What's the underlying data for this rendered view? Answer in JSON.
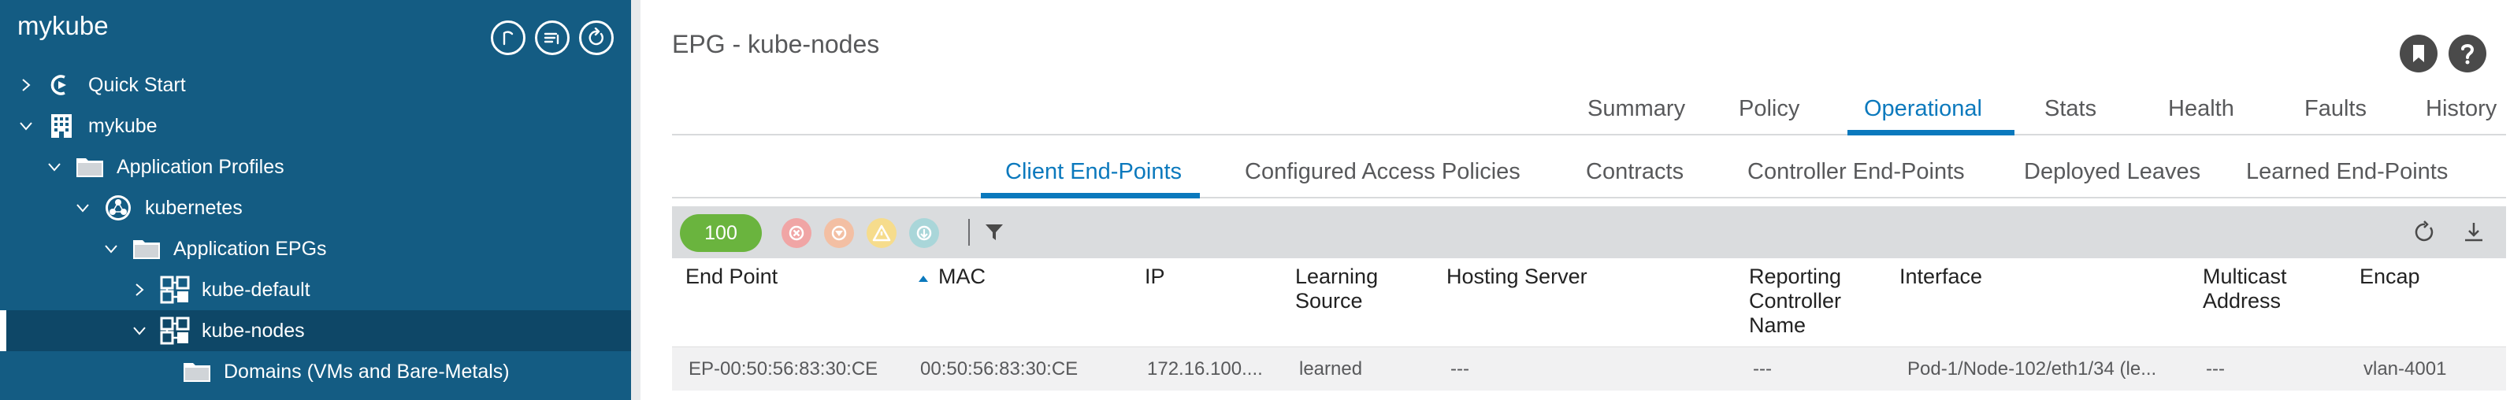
{
  "sidebar": {
    "title": "mykube",
    "actions": [
      {
        "icon": "pin-icon"
      },
      {
        "icon": "list-icon"
      },
      {
        "icon": "refresh-icon"
      }
    ],
    "tree": [
      {
        "label": "Quick Start",
        "icon": "quick-start-icon",
        "expanded": false
      },
      {
        "label": "mykube",
        "icon": "tenant-icon",
        "expanded": true
      },
      {
        "label": "Application Profiles",
        "icon": "folder-icon",
        "expanded": true
      },
      {
        "label": "kubernetes",
        "icon": "app-profile-icon",
        "expanded": true
      },
      {
        "label": "Application EPGs",
        "icon": "folder-icon",
        "expanded": true
      },
      {
        "label": "kube-default",
        "icon": "epg-icon",
        "expanded": false
      },
      {
        "label": "kube-nodes",
        "icon": "epg-icon",
        "expanded": true,
        "selected": true
      },
      {
        "label": "Domains (VMs and Bare-Metals)",
        "icon": "folder-icon"
      }
    ]
  },
  "main": {
    "title": "EPG - kube-nodes",
    "top_icons": [
      "bookmark-icon",
      "help-icon"
    ],
    "tabs": [
      {
        "label": "Summary"
      },
      {
        "label": "Policy"
      },
      {
        "label": "Operational",
        "active": true
      },
      {
        "label": "Stats"
      },
      {
        "label": "Health"
      },
      {
        "label": "Faults"
      },
      {
        "label": "History"
      }
    ],
    "subtabs": [
      {
        "label": "Client End-Points",
        "active": true
      },
      {
        "label": "Configured Access Policies"
      },
      {
        "label": "Contracts"
      },
      {
        "label": "Controller End-Points"
      },
      {
        "label": "Deployed Leaves"
      },
      {
        "label": "Learned End-Points"
      }
    ],
    "toolbar": {
      "count": "100",
      "severity_icons": [
        "critical-icon",
        "major-icon",
        "minor-icon",
        "warning-icon"
      ],
      "filter_icon": "filter-icon",
      "right_icons": [
        "refresh-icon",
        "download-icon"
      ]
    },
    "table": {
      "sort_column": "MAC",
      "sort_direction": "ascending",
      "columns": [
        "End Point",
        "MAC",
        "IP",
        "Learning Source",
        "Hosting Server",
        "Reporting Controller Name",
        "Interface",
        "Multicast Address",
        "Encap"
      ],
      "rows": [
        [
          "EP-00:50:56:83:30:CE",
          "00:50:56:83:30:CE",
          "172.16.100....",
          "learned",
          "---",
          "---",
          "Pod-1/Node-102/eth1/34 (le...",
          "---",
          "vlan-4001"
        ]
      ]
    }
  },
  "colors": {
    "sidebar_bg": "#145c83",
    "sidebar_selected": "#0e4767",
    "accent": "#0b79bd",
    "count_pill": "#6ab43e",
    "critical": "#f0a5a5",
    "major": "#f3bfa3",
    "minor": "#f6dc8c",
    "warning": "#a9d6d9"
  }
}
